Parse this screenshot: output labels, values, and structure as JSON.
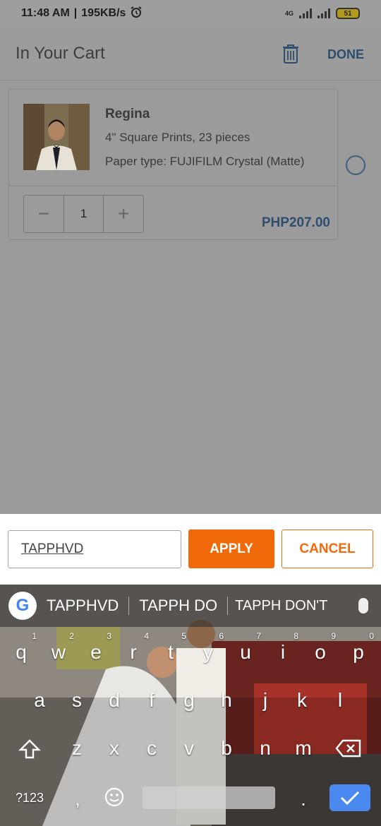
{
  "status": {
    "time": "11:48 AM",
    "speed": "195KB/s",
    "network": "4G",
    "battery": "51"
  },
  "header": {
    "title": "In Your Cart",
    "done_label": "DONE"
  },
  "cart_item": {
    "name": "Regina",
    "description": "4\" Square Prints, 23 pieces",
    "paper": "Paper type: FUJIFILM Crystal (Matte)",
    "quantity": "1",
    "price": "PHP207.00",
    "minus": "−",
    "plus": "+"
  },
  "promo": {
    "code": "TAPPHVD",
    "apply_label": "APPLY",
    "cancel_label": "CANCEL"
  },
  "keyboard": {
    "suggestions": [
      "TAPPHVD",
      "TAPPH DO",
      "TAPPH DON'T"
    ],
    "row1": [
      [
        "q",
        "1"
      ],
      [
        "w",
        "2"
      ],
      [
        "e",
        "3"
      ],
      [
        "r",
        "4"
      ],
      [
        "t",
        "5"
      ],
      [
        "y",
        "6"
      ],
      [
        "u",
        "7"
      ],
      [
        "i",
        "8"
      ],
      [
        "o",
        "9"
      ],
      [
        "p",
        "0"
      ]
    ],
    "row2": [
      "a",
      "s",
      "d",
      "f",
      "g",
      "h",
      "j",
      "k",
      "l"
    ],
    "row3": [
      "z",
      "x",
      "c",
      "v",
      "b",
      "n",
      "m"
    ],
    "symbols_label": "?123",
    "comma": ",",
    "period": "."
  }
}
